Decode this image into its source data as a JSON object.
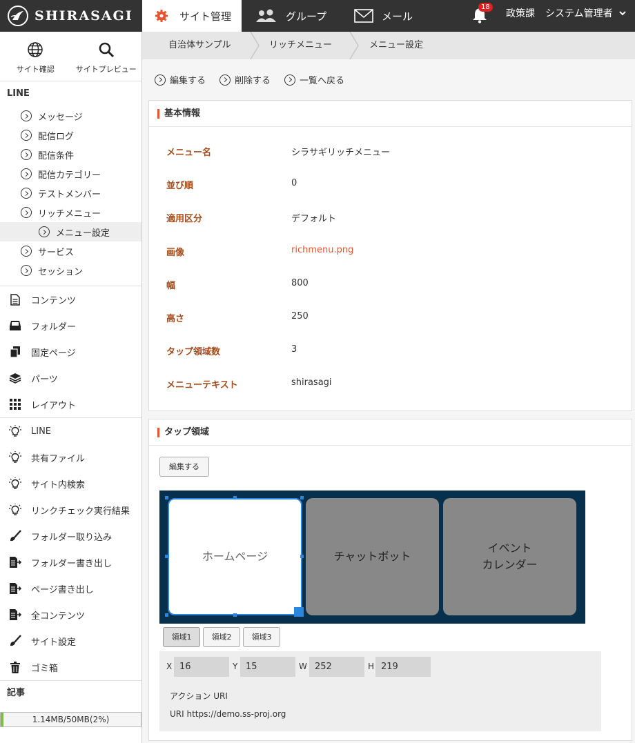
{
  "app": {
    "logo_text": "SHIRASAGI"
  },
  "topnav": {
    "site_admin": "サイト管理",
    "group": "グループ",
    "mail": "メール",
    "notification_count": "18",
    "department": "政策課",
    "user": "システム管理者"
  },
  "sidebar": {
    "quick": {
      "site_check": "サイト確認",
      "site_preview": "サイトプレビュー"
    },
    "line_head": "LINE",
    "line_items": [
      "メッセージ",
      "配信ログ",
      "配信条件",
      "配信カテゴリー",
      "テストメンバー",
      "リッチメニュー",
      "メニュー設定",
      "サービス",
      "セッション"
    ],
    "content_items": [
      "コンテンツ",
      "フォルダー",
      "固定ページ",
      "パーツ",
      "レイアウト"
    ],
    "tool_items": [
      "LINE",
      "共有ファイル",
      "サイト内検索",
      "リンクチェック実行結果",
      "フォルダー取り込み",
      "フォルダー書き出し",
      "ページ書き出し",
      "全コンテンツ",
      "サイト設定",
      "ゴミ箱"
    ],
    "article_head": "記事",
    "quota": {
      "text": "1.14MB/50MB(2%)",
      "percent": 2
    }
  },
  "breadcrumb": [
    "自治体サンプル",
    "リッチメニュー",
    "メニュー設定"
  ],
  "actions": {
    "edit": "編集する",
    "delete": "削除する",
    "back": "一覧へ戻る"
  },
  "basic_info": {
    "title": "基本情報",
    "rows": [
      {
        "label": "メニュー名",
        "value": "シラサギリッチメニュー"
      },
      {
        "label": "並び順",
        "value": "0"
      },
      {
        "label": "適用区分",
        "value": "デフォルト"
      },
      {
        "label": "画像",
        "value": "richmenu.png"
      },
      {
        "label": "幅",
        "value": "800"
      },
      {
        "label": "高さ",
        "value": "250"
      },
      {
        "label": "タップ領域数",
        "value": "3"
      },
      {
        "label": "メニューテキスト",
        "value": "shirasagi"
      }
    ]
  },
  "tap_area": {
    "title": "タップ領域",
    "edit_label": "編集する",
    "areas": [
      "ホームページ",
      "チャットボット",
      "イベント\nカレンダー"
    ],
    "tabs": [
      "領域1",
      "領域2",
      "領域3"
    ],
    "coords": {
      "x_label": "X",
      "x": "16",
      "y_label": "Y",
      "y": "15",
      "w_label": "W",
      "w": "252",
      "h_label": "H",
      "h": "219"
    },
    "action_uri_label": "アクション URI",
    "uri_line": "URI https://demo.ss-proj.org"
  },
  "colors": {
    "accent": "#e8542f",
    "label": "#a24d1e",
    "topbar": "#333333",
    "rich_bg": "#07304d",
    "selection": "#2b86e0"
  }
}
